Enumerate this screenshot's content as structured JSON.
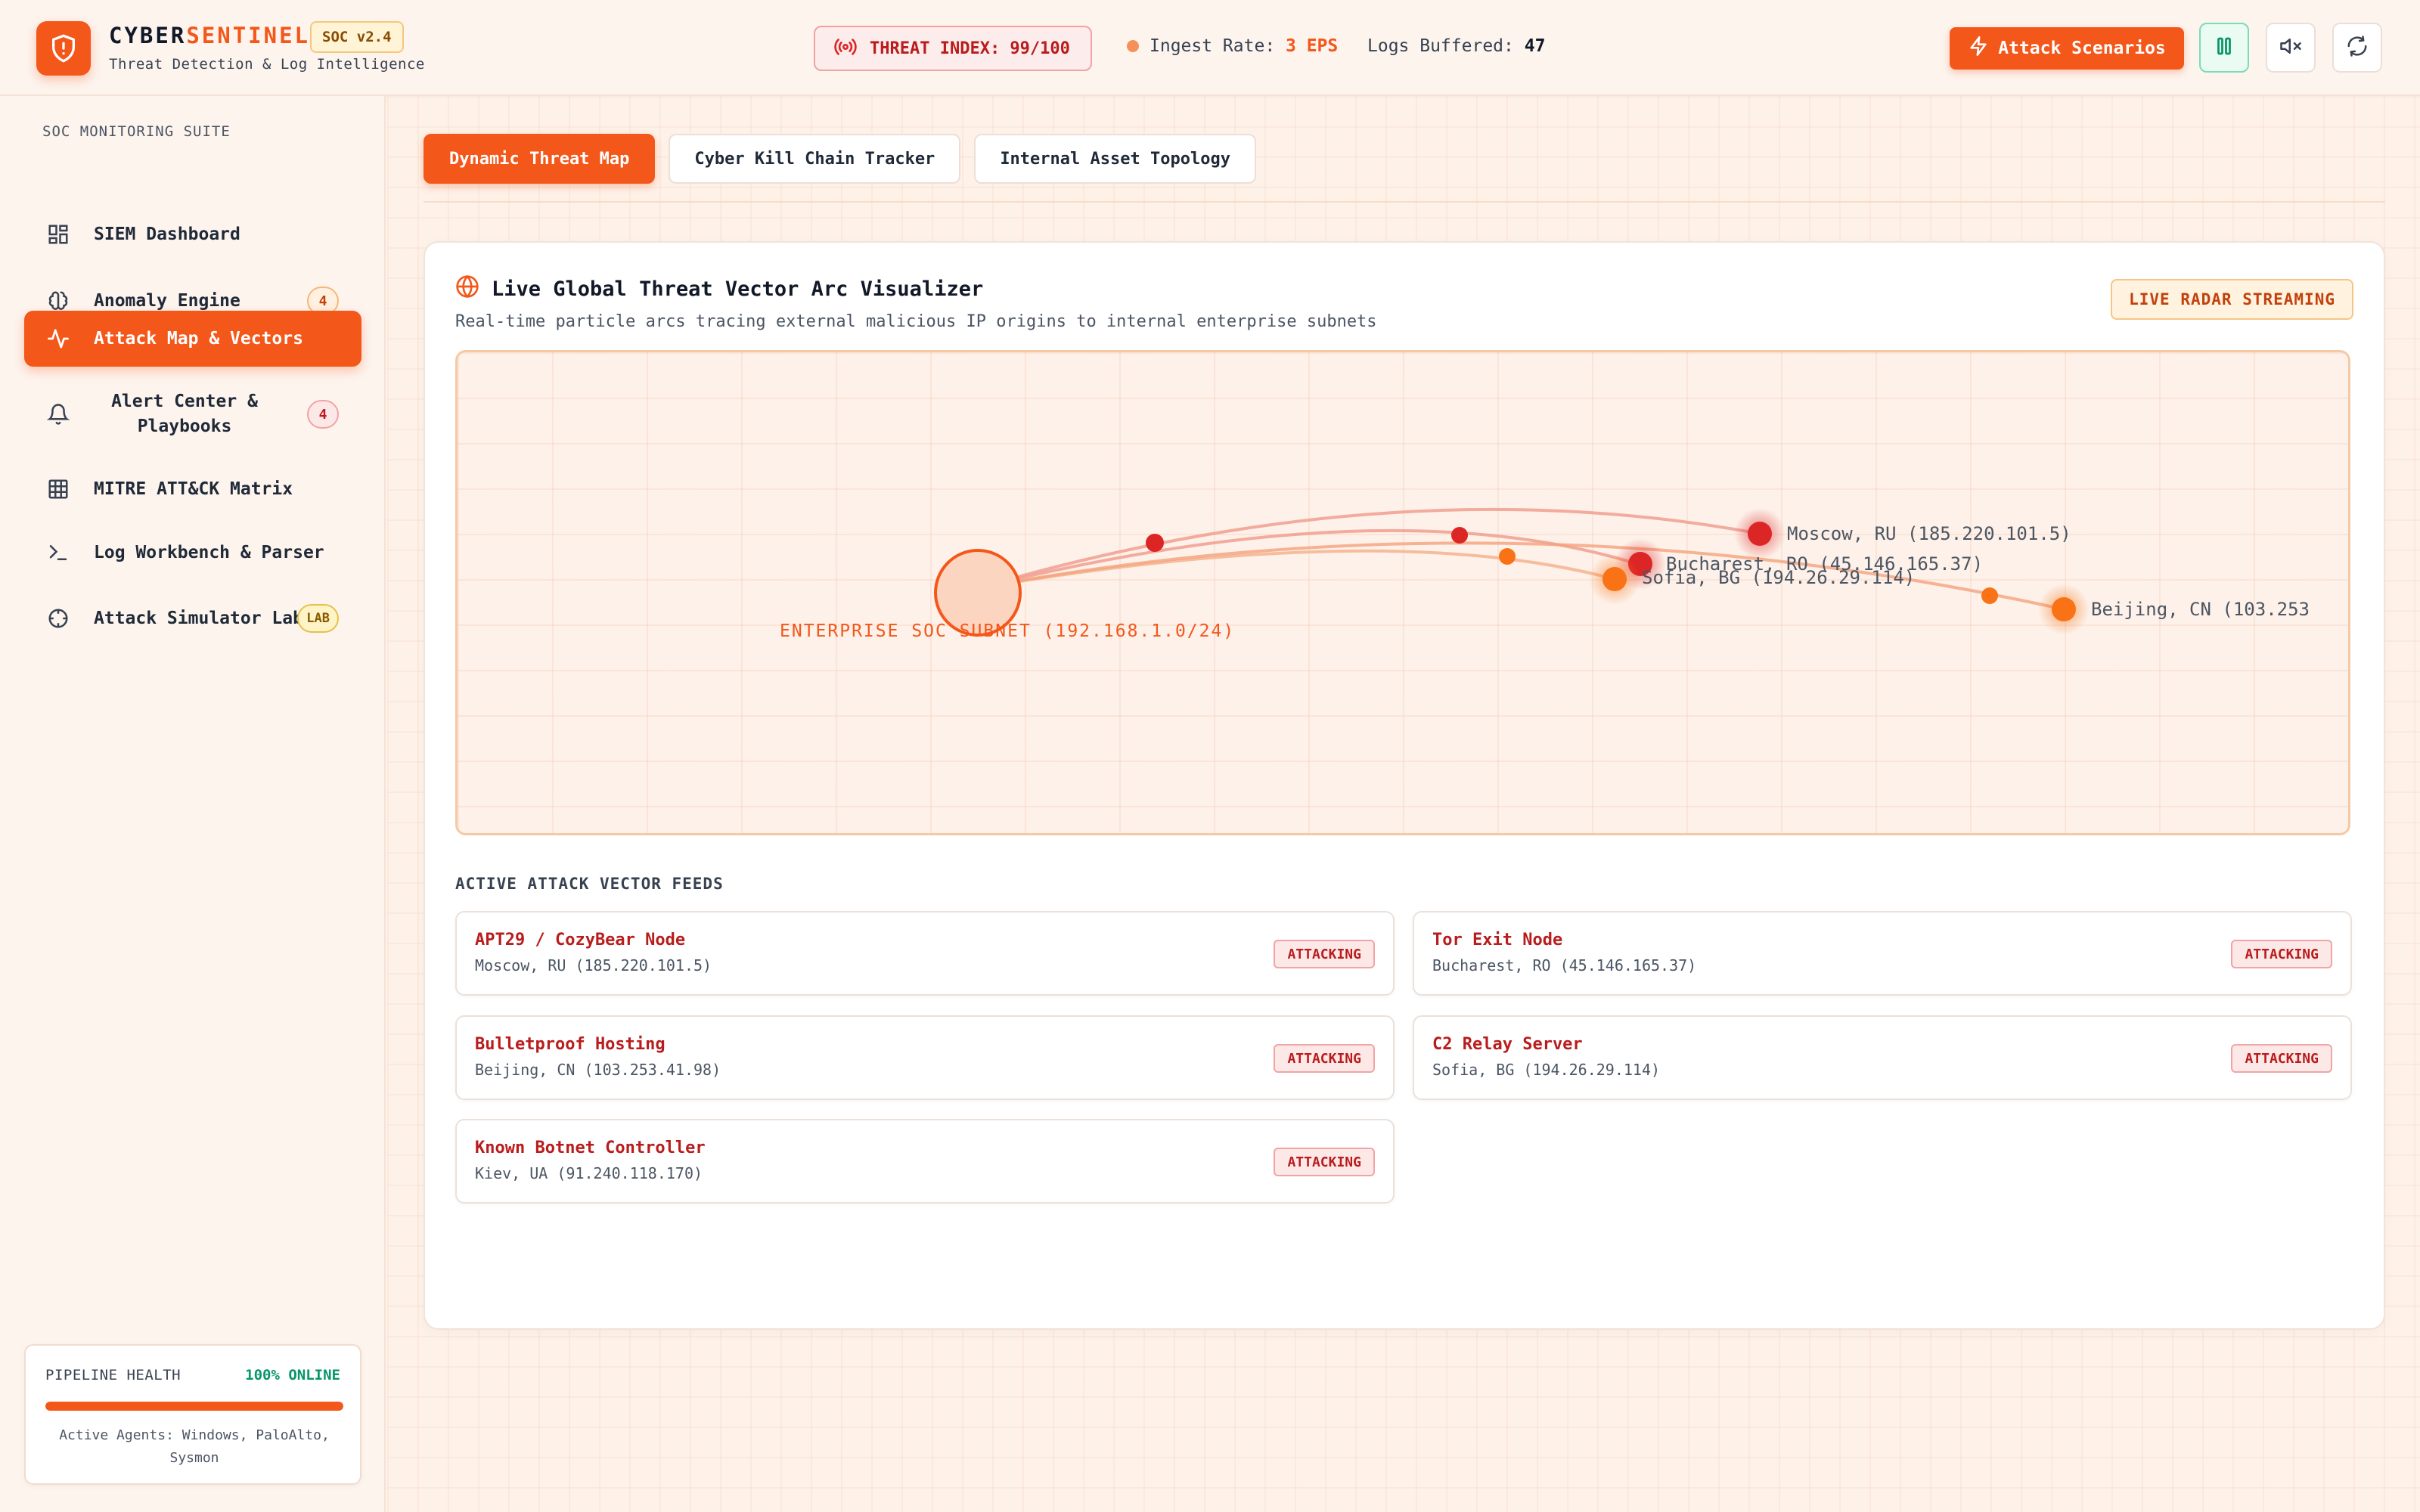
{
  "header": {
    "brand_prefix": "CYBER",
    "brand_suffix": "SENTINEL",
    "version": "SOC v2.4",
    "tagline": "Threat Detection & Log Intelligence",
    "threat_index": "THREAT INDEX: 99/100",
    "ingest_label": "Ingest Rate: ",
    "ingest_value": "3 EPS",
    "buffered_label": "Logs Buffered: ",
    "buffered_value": "47",
    "attack_button": "Attack Scenarios",
    "pause_icon": "pause-icon",
    "mute_icon": "volume-mute-icon",
    "refresh_icon": "refresh-icon"
  },
  "sidebar": {
    "title": "SOC MONITORING SUITE",
    "items": [
      {
        "label": "SIEM Dashboard",
        "icon": "dashboard-icon"
      },
      {
        "label": "Anomaly Engine",
        "icon": "brain-icon",
        "badge": "4"
      },
      {
        "label": "Attack Map & Vectors",
        "icon": "activity-icon",
        "active": true
      },
      {
        "label": "Alert Center & Playbooks",
        "icon": "bell-icon",
        "badge": "4"
      },
      {
        "label": "MITRE ATT&CK Matrix",
        "icon": "grid-icon"
      },
      {
        "label": "Log Workbench & Parser",
        "icon": "terminal-icon"
      },
      {
        "label": "Attack Simulator Lab",
        "icon": "crosshair-icon",
        "badge": "LAB"
      }
    ],
    "health": {
      "title": "PIPELINE HEALTH",
      "status": "100% ONLINE",
      "level": 1.0,
      "agents": "Active Agents: Windows, PaloAlto, Sysmon"
    }
  },
  "tabs": [
    "Dynamic Threat Map",
    "Cyber Kill Chain Tracker",
    "Internal Asset Topology"
  ],
  "panel": {
    "title": "Live Global Threat Vector Arc Visualizer",
    "subtitle": "Real-time particle arcs tracing external malicious IP origins to internal enterprise subnets",
    "badge": "LIVE RADAR STREAMING",
    "map": {
      "target_label": "ENTERPRISE SOC SUBNET (192.168.1.0/24)",
      "nodes": [
        {
          "label": "Moscow, RU (185.220.101.5)"
        },
        {
          "label": "Bucharest, RO (45.146.165.37)"
        },
        {
          "label": "Sofia, BG (194.26.29.114)"
        },
        {
          "label": "Beijing, CN (103.253"
        }
      ]
    },
    "feeds_title": "ACTIVE ATTACK VECTOR FEEDS",
    "feeds": [
      {
        "name": "APT29 / CozyBear Node",
        "location": "Moscow, RU (185.220.101.5)",
        "status": "ATTACKING"
      },
      {
        "name": "Tor Exit Node",
        "location": "Bucharest, RO (45.146.165.37)",
        "status": "ATTACKING"
      },
      {
        "name": "Bulletproof Hosting",
        "location": "Beijing, CN (103.253.41.98)",
        "status": "ATTACKING"
      },
      {
        "name": "C2 Relay Server",
        "location": "Sofia, BG (194.26.29.114)",
        "status": "ATTACKING"
      },
      {
        "name": "Known Botnet Controller",
        "location": "Kiev, UA (91.240.118.170)",
        "status": "ATTACKING"
      }
    ]
  },
  "colors": {
    "accent": "#f4571a",
    "danger": "#b91c1c",
    "success": "#059669"
  }
}
